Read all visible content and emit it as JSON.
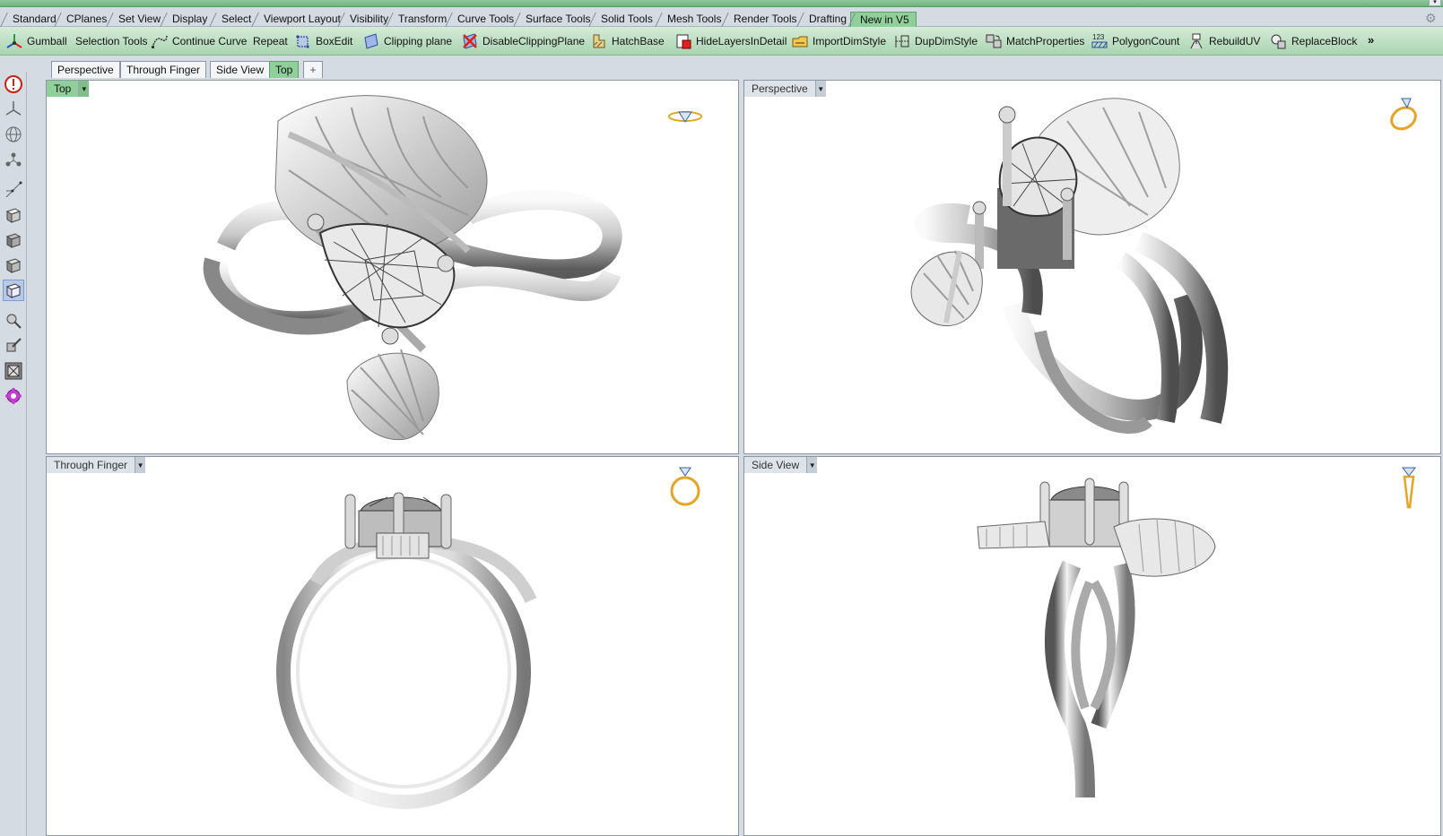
{
  "colors": {
    "accent_green": "#8fcf9a",
    "toolbar_green": "#a9d3b0",
    "viewport_bg": "#ffffff",
    "frame": "#d4dbe3",
    "nav_icon_gold": "#e3a528"
  },
  "group_tabs": [
    {
      "label": "Standard"
    },
    {
      "label": "CPlanes"
    },
    {
      "label": "Set View"
    },
    {
      "label": "Display"
    },
    {
      "label": "Select"
    },
    {
      "label": "Viewport Layout"
    },
    {
      "label": "Visibility"
    },
    {
      "label": "Transform"
    },
    {
      "label": "Curve Tools"
    },
    {
      "label": "Surface Tools"
    },
    {
      "label": "Solid Tools"
    },
    {
      "label": "Mesh Tools"
    },
    {
      "label": "Render Tools"
    },
    {
      "label": "Drafting"
    },
    {
      "label": "New in V5"
    }
  ],
  "active_group_tab": "New in V5",
  "commands": [
    {
      "label": "Gumball",
      "icon": "gumball-icon"
    },
    {
      "label": "Selection Tools",
      "icon": ""
    },
    {
      "label": "Continue Curve",
      "icon": "continue-curve-icon"
    },
    {
      "label": "Repeat",
      "icon": ""
    },
    {
      "label": "BoxEdit",
      "icon": "boxedit-icon"
    },
    {
      "label": "Clipping plane",
      "icon": "clipping-plane-icon"
    },
    {
      "label": "DisableClippingPlane",
      "icon": "disable-clipping-icon"
    },
    {
      "label": "HatchBase",
      "icon": "hatchbase-icon"
    },
    {
      "label": "HideLayersInDetail",
      "icon": "hide-layers-icon"
    },
    {
      "label": "ImportDimStyle",
      "icon": "import-dimstyle-icon"
    },
    {
      "label": "DupDimStyle",
      "icon": "dup-dimstyle-icon"
    },
    {
      "label": "MatchProperties",
      "icon": "match-properties-icon"
    },
    {
      "label": "PolygonCount",
      "icon": "polygon-count-icon",
      "icon_text": "123"
    },
    {
      "label": "RebuildUV",
      "icon": "rebuild-uv-icon"
    },
    {
      "label": "ReplaceBlock",
      "icon": "replace-block-icon"
    }
  ],
  "overflow_label": "»",
  "viewport_tabs": [
    {
      "label": "Perspective"
    },
    {
      "label": "Through Finger"
    },
    {
      "label": "Side View"
    },
    {
      "label": "Top"
    }
  ],
  "active_viewport_tab": "Top",
  "add_tab_label": "+",
  "viewports": {
    "top": {
      "label": "Top",
      "active": true
    },
    "perspective": {
      "label": "Perspective",
      "active": false
    },
    "through_finger": {
      "label": "Through Finger",
      "active": false
    },
    "side_view": {
      "label": "Side View",
      "active": false
    }
  },
  "left_toolbar": [
    "info-icon",
    "cplane-icon",
    "globe-icon",
    "gumball-axes-icon",
    "points-icon",
    "box-view-1-icon",
    "box-view-2-icon",
    "box-view-3-icon",
    "box-view-4-icon",
    "edit-pen-icon",
    "cut-pen-icon",
    "boolean-box-icon",
    "plugin-gear-icon"
  ]
}
